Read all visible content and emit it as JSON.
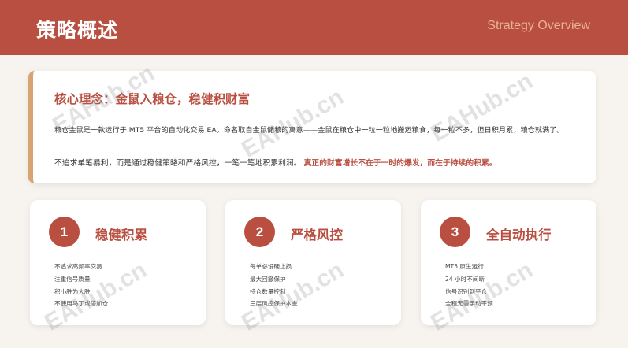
{
  "header": {
    "title": "策略概述",
    "subtitle": "Strategy Overview"
  },
  "intro": {
    "title": "核心理念：金鼠入粮仓，稳健积财富",
    "paragraph1": "粮仓金鼠是一款运行于 MT5 平台的自动化交易 EA。命名取自金鼠储粮的寓意——金鼠在粮仓中一粒一粒地搬运粮食，每一粒不多，但日积月累，粮仓就满了。",
    "paragraph2_plain": "不追求单笔暴利，而是通过稳健策略和严格风控，一笔一笔地积累利润。",
    "paragraph2_highlight": "真正的财富增长不在于一时的爆发，而在于持续的积累。"
  },
  "cards": [
    {
      "number": "1",
      "title": "稳健积累",
      "items": [
        "不追求高频率交易",
        "注重信号质量",
        "积小胜为大胜",
        "不使用马丁或倍加仓"
      ]
    },
    {
      "number": "2",
      "title": "严格风控",
      "items": [
        "每单必设硬止损",
        "最大回撤保护",
        "持仓数量控制",
        "三层风控保护本金"
      ]
    },
    {
      "number": "3",
      "title": "全自动执行",
      "items": [
        "MT5 原生运行",
        "24 小时不间断",
        "信号识别到平仓",
        "全程无需手动干预"
      ]
    }
  ],
  "watermark": "EAHub.cn",
  "colors": {
    "primary": "#b94f41",
    "accent_border": "#d7a46f",
    "subtitle": "#e9b38f",
    "background": "#f7f3ee"
  }
}
